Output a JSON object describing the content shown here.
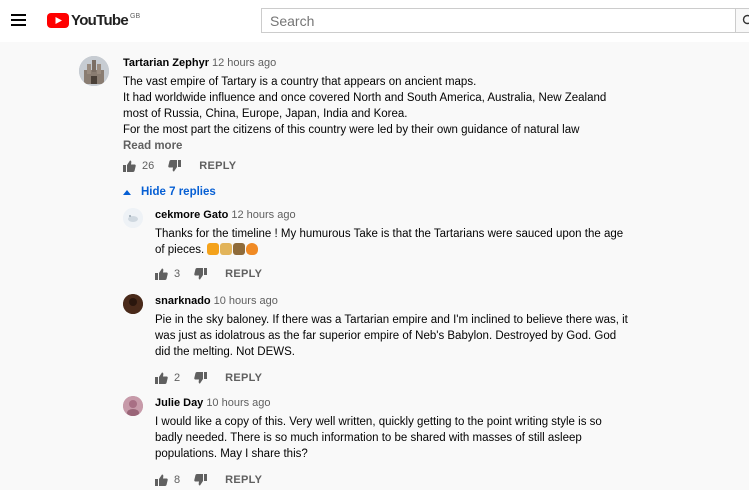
{
  "header": {
    "logo_text": "YouTube",
    "region": "GB",
    "search_placeholder": "Search"
  },
  "main_comment": {
    "author": "Tartarian Zephyr",
    "time": "12 hours ago",
    "lines": [
      "The vast empire of Tartary is a country that appears on ancient maps.",
      "It had worldwide influence and once covered North and South America, Australia, New Zealand",
      "most of Russia, China, Europe, Japan, India and Korea.",
      "For the most part the citizens of this country were led by their own guidance of natural law"
    ],
    "read_more": "Read more",
    "likes": "26",
    "reply_label": "REPLY"
  },
  "hide_replies_label": "Hide 7 replies",
  "replies": [
    {
      "author": "cekmore Gato",
      "time": "12 hours ago",
      "lines": [
        "Thanks for the timeline !  My humurous Take is that the Tartarians were sauced upon the age",
        "of pieces."
      ],
      "likes": "3",
      "reply_label": "REPLY"
    },
    {
      "author": "snarknado",
      "time": "10 hours ago",
      "lines": [
        "Pie in the sky baloney. If there was a Tartarian empire and I'm inclined to believe there was, it",
        "was just as idolatrous as the far superior empire of Neb's Babylon. Destroyed by God. God",
        "did the melting. Not DEWS."
      ],
      "likes": "2",
      "reply_label": "REPLY"
    },
    {
      "author": "Julie Day",
      "time": "10 hours ago",
      "lines": [
        "I would like a copy of this. Very well written, quickly getting to the point writing style is so",
        "badly needed. There is so much information to be shared with masses of still asleep",
        "populations. May I share this?"
      ],
      "likes": "8",
      "reply_label": "REPLY"
    }
  ],
  "colors": {
    "brand_red": "#ff0000",
    "link_blue": "#065fd4",
    "secondary_text": "#606060"
  }
}
